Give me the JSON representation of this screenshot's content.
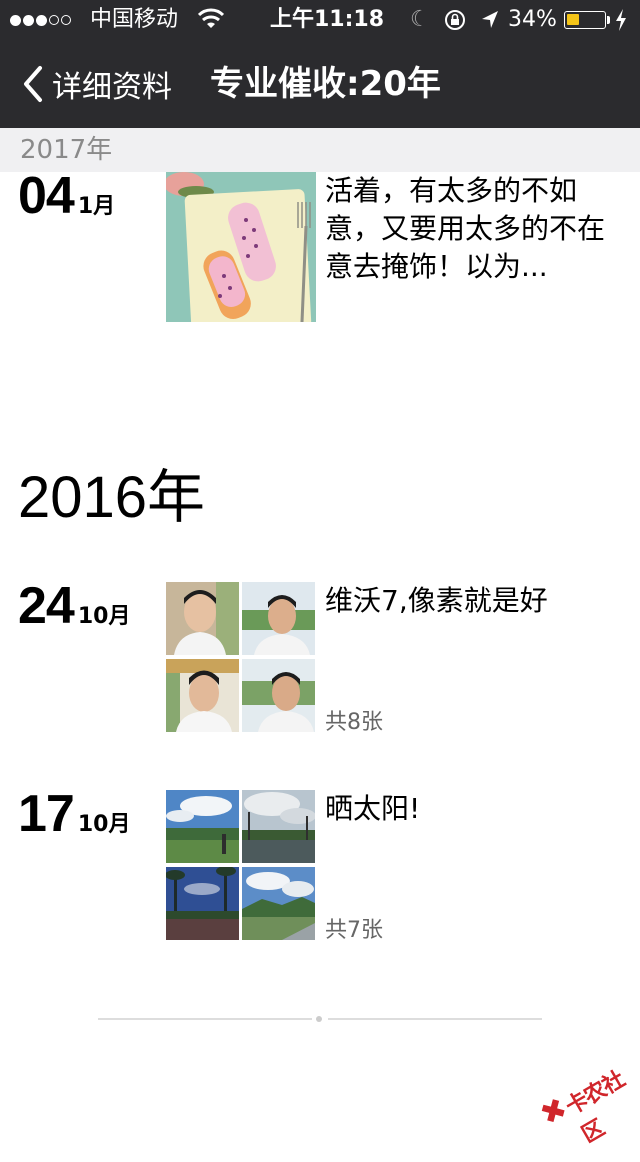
{
  "status_bar": {
    "carrier": "中国移动",
    "time": "上午11:18",
    "battery": "34%",
    "icons": [
      "wifi-icon",
      "moon-icon",
      "rotation-lock-icon",
      "location-arrow-icon",
      "battery-icon",
      "charging-bolt-icon"
    ],
    "signal_bars_filled": 3,
    "signal_bars_total": 5
  },
  "nav": {
    "back_label": "详细资料",
    "title": "专业催收:20年"
  },
  "sticky_year": "2017年",
  "year_heading": "2016年",
  "entries": [
    {
      "day": "04",
      "month": "1月",
      "caption": "活着，有太多的不如意，又要用太多的不在意去掩饰！以为...",
      "count": ""
    },
    {
      "day": "24",
      "month": "10月",
      "caption": "维沃7,像素就是好",
      "count": "共8张"
    },
    {
      "day": "17",
      "month": "10月",
      "caption": "晒太阳!",
      "count": "共7张"
    }
  ],
  "watermark": {
    "text": "卡农社区"
  },
  "colors": {
    "bar_bg": "#2b2b2e",
    "sticky_bg": "#f0f0f2",
    "battery_fill": "#f5c518",
    "watermark": "#d0262b"
  }
}
